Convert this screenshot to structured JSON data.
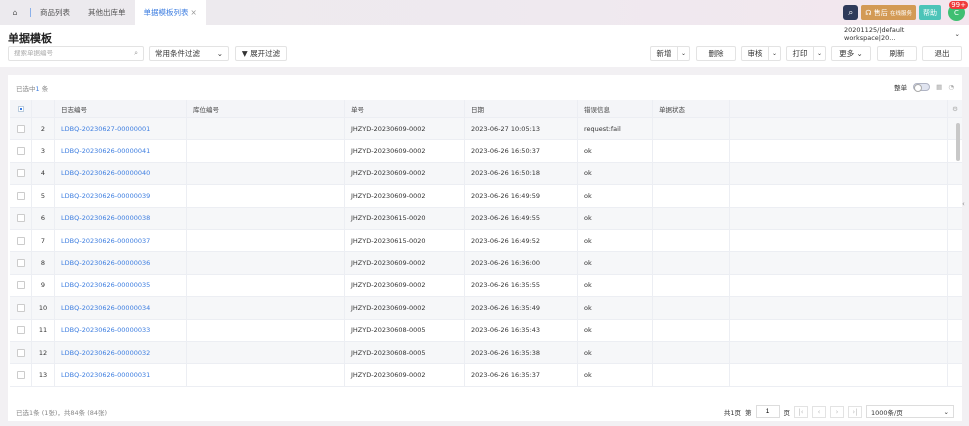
{
  "tabs": [
    {
      "label": "商品列表"
    },
    {
      "label": "其他出库单"
    },
    {
      "label": "单据模板列表",
      "active": true
    }
  ],
  "topbar": {
    "service_label": "售后",
    "service_sub": "在线服务",
    "help_label": "帮助",
    "badge": "99+",
    "avatar": "C"
  },
  "page": {
    "title": "单据模板",
    "workspace": "20201125/|default workspace|20..."
  },
  "filters": {
    "search_placeholder": "搜索单据编号",
    "common_filter": "常用条件过滤",
    "expand_filter": "展开过滤"
  },
  "toolbar": {
    "add": "新增",
    "delete": "删除",
    "audit": "审核",
    "print": "打印",
    "more": "更多",
    "refresh": "刷新",
    "exit": "退出"
  },
  "table": {
    "selected_prefix": "已选中",
    "selected_count": "1",
    "selected_suffix": "条",
    "whole_label": "整单",
    "columns": [
      "日志编号",
      "库位编号",
      "单号",
      "日期",
      "错误信息",
      "单据状态"
    ],
    "rows": [
      {
        "idx": "2",
        "log": "LDBQ-20230627-00000001",
        "loc": "",
        "no": "JHZYD-20230609-0002",
        "date": "2023-06-27 10:05:13",
        "err": "request:fail",
        "status": ""
      },
      {
        "idx": "3",
        "log": "LDBQ-20230626-00000041",
        "loc": "",
        "no": "JHZYD-20230609-0002",
        "date": "2023-06-26 16:50:37",
        "err": "ok",
        "status": ""
      },
      {
        "idx": "4",
        "log": "LDBQ-20230626-00000040",
        "loc": "",
        "no": "JHZYD-20230609-0002",
        "date": "2023-06-26 16:50:18",
        "err": "ok",
        "status": ""
      },
      {
        "idx": "5",
        "log": "LDBQ-20230626-00000039",
        "loc": "",
        "no": "JHZYD-20230609-0002",
        "date": "2023-06-26 16:49:59",
        "err": "ok",
        "status": ""
      },
      {
        "idx": "6",
        "log": "LDBQ-20230626-00000038",
        "loc": "",
        "no": "JHZYD-20230615-0020",
        "date": "2023-06-26 16:49:55",
        "err": "ok",
        "status": ""
      },
      {
        "idx": "7",
        "log": "LDBQ-20230626-00000037",
        "loc": "",
        "no": "JHZYD-20230615-0020",
        "date": "2023-06-26 16:49:52",
        "err": "ok",
        "status": ""
      },
      {
        "idx": "8",
        "log": "LDBQ-20230626-00000036",
        "loc": "",
        "no": "JHZYD-20230609-0002",
        "date": "2023-06-26 16:36:00",
        "err": "ok",
        "status": ""
      },
      {
        "idx": "9",
        "log": "LDBQ-20230626-00000035",
        "loc": "",
        "no": "JHZYD-20230609-0002",
        "date": "2023-06-26 16:35:55",
        "err": "ok",
        "status": ""
      },
      {
        "idx": "10",
        "log": "LDBQ-20230626-00000034",
        "loc": "",
        "no": "JHZYD-20230609-0002",
        "date": "2023-06-26 16:35:49",
        "err": "ok",
        "status": ""
      },
      {
        "idx": "11",
        "log": "LDBQ-20230626-00000033",
        "loc": "",
        "no": "JHZYD-20230608-0005",
        "date": "2023-06-26 16:35:43",
        "err": "ok",
        "status": ""
      },
      {
        "idx": "12",
        "log": "LDBQ-20230626-00000032",
        "loc": "",
        "no": "JHZYD-20230608-0005",
        "date": "2023-06-26 16:35:38",
        "err": "ok",
        "status": ""
      },
      {
        "idx": "13",
        "log": "LDBQ-20230626-00000031",
        "loc": "",
        "no": "JHZYD-20230609-0002",
        "date": "2023-06-26 16:35:37",
        "err": "ok",
        "status": ""
      }
    ]
  },
  "footer": {
    "summary": "已选1条 (1张)，共84条 (84张)",
    "total_pages": "共1页",
    "page_prefix": "第",
    "page": "1",
    "page_suffix": "页",
    "page_size": "1000条/页"
  },
  "colors": {
    "accent": "#3c7de0",
    "search_btn": "#2f3a5a",
    "service": "#d39a55",
    "help": "#4cc4b8",
    "avatar": "#3fbf72",
    "badge": "#f03a3a"
  }
}
